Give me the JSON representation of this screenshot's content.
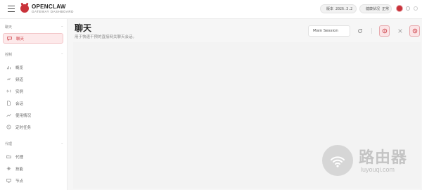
{
  "app": {
    "brand_title": "OPENCLAW",
    "brand_subtitle": "GATEWAY DASHBOARD",
    "accent_color": "#c9323a"
  },
  "status": {
    "version_label": "版本",
    "version_value": "2026.3.2",
    "health_label": "健康状况",
    "health_value": "正常"
  },
  "sidebar": {
    "sections": [
      {
        "title": "聊天",
        "items": [
          {
            "label": "聊天",
            "icon": "chat-bubble-icon",
            "active": true
          }
        ]
      },
      {
        "title": "控制",
        "items": [
          {
            "label": "概览",
            "icon": "bar-chart-icon"
          },
          {
            "label": "频道",
            "icon": "link-icon"
          },
          {
            "label": "实例",
            "icon": "broadcast-icon"
          },
          {
            "label": "会话",
            "icon": "document-icon"
          },
          {
            "label": "使用情况",
            "icon": "usage-chart-icon"
          },
          {
            "label": "定时任务",
            "icon": "clock-icon"
          }
        ]
      },
      {
        "title": "代理",
        "items": [
          {
            "label": "代理",
            "icon": "folder-icon"
          },
          {
            "label": "技能",
            "icon": "sparkle-icon"
          },
          {
            "label": "节点",
            "icon": "monitor-icon"
          }
        ]
      }
    ]
  },
  "main": {
    "title": "聊天",
    "subtitle": "用于快速干预的直接网关聊天会话。",
    "session_select": "Main Session"
  },
  "watermark": {
    "text": "路由器",
    "url": "luyouqi.com"
  }
}
